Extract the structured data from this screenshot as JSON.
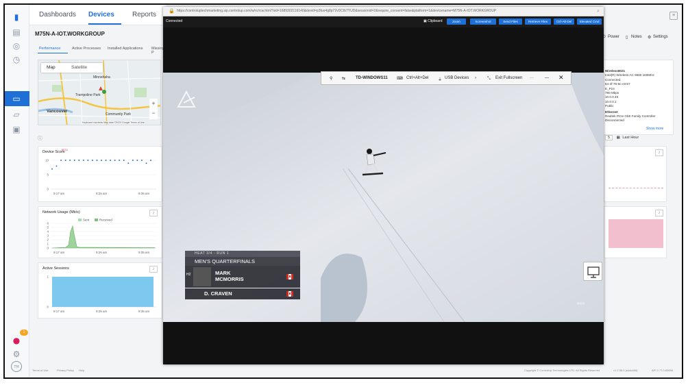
{
  "nav": {
    "tabs": [
      "Dashboards",
      "Devices",
      "Reports"
    ]
  },
  "device": {
    "title": "M75N-A-IOT.WORKGROUP",
    "subtabs": [
      "Performance",
      "Active Processes",
      "Installed Applications",
      "Missing P"
    ]
  },
  "map": {
    "tab_map": "Map",
    "tab_satellite": "Satellite",
    "labels": [
      "Minnehaha",
      "Trampoline Park",
      "Vancouver",
      "Community Park"
    ],
    "footer": "Keyboard shortcuts   Map data ©2023 Google   Terms of Use",
    "zoom_in": "+",
    "zoom_out": "−"
  },
  "charts": {
    "device_score": {
      "title": "Device Score",
      "beta": "BETA",
      "y_ticks": [
        "10",
        "5",
        "0"
      ],
      "x_ticks": [
        "9:17 am",
        "9:26 am",
        "9:35 am"
      ],
      "values": [
        7,
        8,
        10,
        10,
        10,
        10,
        10,
        10,
        10,
        10,
        10,
        10,
        10,
        10,
        10,
        10,
        10,
        9,
        10,
        10,
        10,
        9,
        10
      ]
    },
    "network_usage": {
      "title": "Network Usage (Mb/s)",
      "legend": [
        "Sent",
        "Received"
      ],
      "y_ticks": [
        "6",
        "5",
        "4",
        "3",
        "2",
        "1",
        "0"
      ],
      "x_ticks": [
        "9:17 am",
        "9:26 am",
        "9:35 am"
      ]
    },
    "active_sessions": {
      "title": "Active Sessions",
      "y_ticks": [
        "1",
        "0"
      ],
      "x_ticks": [
        "9:17 am",
        "9:26 am",
        "9:35 am"
      ]
    }
  },
  "right": {
    "power": "Power",
    "notes": "Notes",
    "settings": "Settings",
    "info": [
      "Wireless8021",
      "Intel(R) Wireless-AC 9560 160MHz",
      "Connected",
      "64-4f-76-9c-c8-67",
      "E_P24",
      "780 Mbps",
      "10.0.0.45",
      "10.0.0.1",
      "Public",
      "Ethernet",
      "Realtek PCIe GbE Family Controller",
      "Disconnected"
    ],
    "show_more": "Show more",
    "range_value": "5",
    "last_hour": "Last Hour"
  },
  "remote": {
    "url": "https://controluptechmarketing.sip.controlup.com/w/rc/rcw.html?sid=1689302116140&devid=p3fuo4g8p72vDCIb7YUD&sessionid=2&require_consent=false&platform=1&devicename=M75N-A-IOT.WORKGROUP",
    "status": "Connected",
    "clipboard": "Clipboard",
    "buttons": [
      "Zoom",
      "Screenshot",
      "Send Files",
      "Retrieve Files",
      "Ctrl-Alt-Del",
      "Elevated Cmd"
    ],
    "vbar": {
      "machine": "TD-WINDOWS11",
      "cad": "Ctrl+Alt+Del",
      "usb": "USB Devices",
      "exit": "Exit Fullscreen",
      "more": "···"
    },
    "scoreboard": {
      "heat": "HEAT 3/4 - RUN 1",
      "round": "MEN'S QUARTERFINALS",
      "tag": "H2",
      "rider1_first": "MARK",
      "rider1_last": "MCMORRIS",
      "rider2": "D. CRAVEN"
    }
  },
  "footer": {
    "links": [
      "Terms of Use",
      "Privacy Policy",
      "Help"
    ],
    "copyright": "Copyright © ControlUp Technologies LTD. All Rights Reserved",
    "version": "v1.2.58.0 (s4uid4f4)",
    "api": "API 2.77.0.83656"
  },
  "badge": "1"
}
